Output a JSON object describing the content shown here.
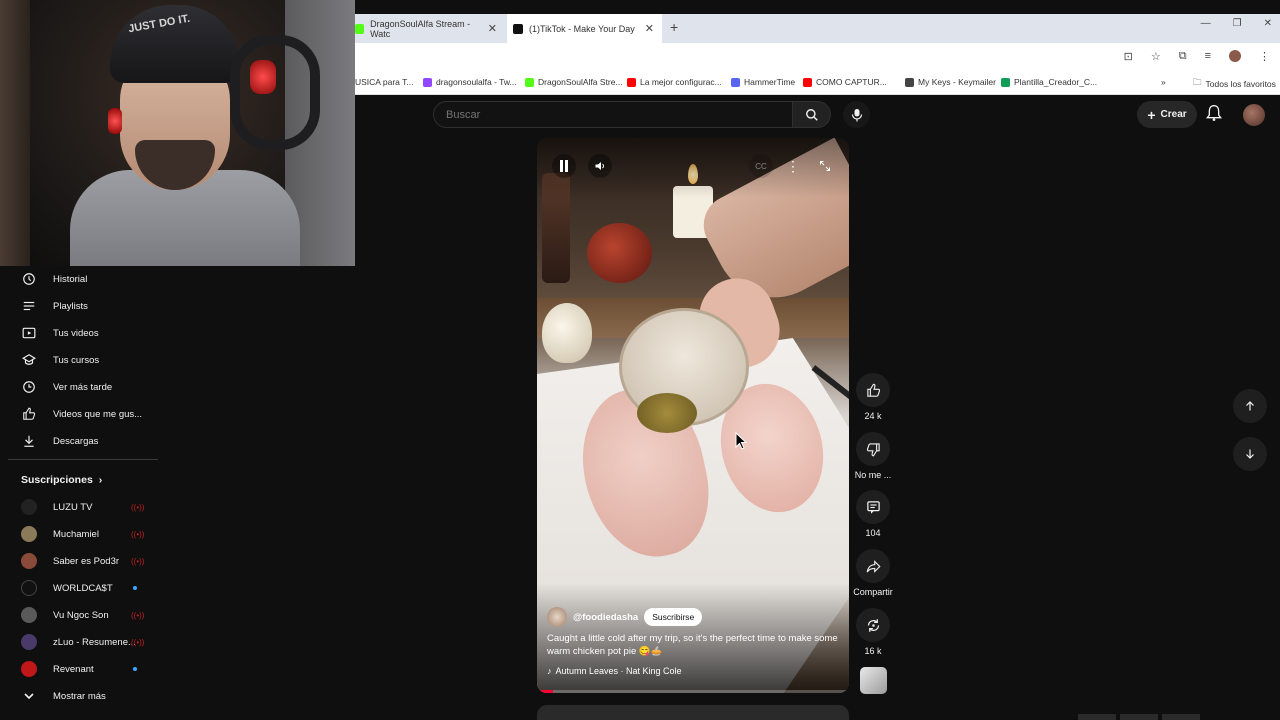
{
  "browser": {
    "tabs": [
      {
        "title": "DragonSoulAlfa Stream - Watc",
        "color": "#53fc18",
        "active": false
      },
      {
        "title": "(1)TikTok - Make Your Day",
        "color": "#111111",
        "active": true
      }
    ],
    "new_tab": "+",
    "bookmarks": [
      {
        "label": "USICA para T...",
        "color": "#888888"
      },
      {
        "label": "dragonsoulalfa - Tw...",
        "color": "#9146ff"
      },
      {
        "label": "DragonSoulAlfa Stre...",
        "color": "#53fc18"
      },
      {
        "label": "La mejor configurac...",
        "color": "#ff0000"
      },
      {
        "label": "HammerTime",
        "color": "#5865f2"
      },
      {
        "label": "COMO CAPTUR...",
        "color": "#ff0000"
      },
      {
        "label": "My Keys - Keymailer",
        "color": "#444444"
      },
      {
        "label": "Plantilla_Creador_C...",
        "color": "#0f9d58"
      }
    ],
    "bookmarks_more": "»",
    "all_bookmarks": "Todos los favoritos"
  },
  "masthead": {
    "search_placeholder": "Buscar",
    "create_label": "Crear"
  },
  "sidebar": {
    "items": [
      {
        "label": "Historial",
        "icon": "history-icon"
      },
      {
        "label": "Playlists",
        "icon": "playlists-icon"
      },
      {
        "label": "Tus videos",
        "icon": "your-videos-icon"
      },
      {
        "label": "Tus cursos",
        "icon": "courses-icon"
      },
      {
        "label": "Ver más tarde",
        "icon": "watch-later-icon"
      },
      {
        "label": "Videos que me gus...",
        "icon": "liked-icon"
      },
      {
        "label": "Descargas",
        "icon": "download-icon"
      }
    ],
    "subscriptions_title": "Suscripciones",
    "subscriptions": [
      {
        "label": "LUZU TV",
        "color": "#222222",
        "status": "live"
      },
      {
        "label": "Muchamiel",
        "color": "#8a7a5a",
        "status": "live"
      },
      {
        "label": "Saber es Pod3r",
        "color": "#8a4a3a",
        "status": "live"
      },
      {
        "label": "WORLDCA$T",
        "color": "#111111",
        "status": "new"
      },
      {
        "label": "Vu Ngoc Son",
        "color": "#5a5a5a",
        "status": "live"
      },
      {
        "label": "zLuo - Resumene...",
        "color": "#4a3a6a",
        "status": "live"
      },
      {
        "label": "Revenant",
        "color": "#c01818",
        "status": "new"
      }
    ],
    "show_more": "Mostrar más"
  },
  "short": {
    "channel": "@foodiedasha",
    "subscribe_label": "Suscribirse",
    "caption": "Caught a little cold after my trip, so it's the perfect time to make some warm chicken pot pie 😋🥧",
    "music": "Autumn Leaves · Nat King Cole",
    "progress": 0.05
  },
  "actions": {
    "likes": "24 k",
    "dislike": "No me ...",
    "comments": "104",
    "share": "Compartir",
    "remix": "16 k"
  },
  "webcam": {
    "beanie_text": "JUST DO IT."
  }
}
